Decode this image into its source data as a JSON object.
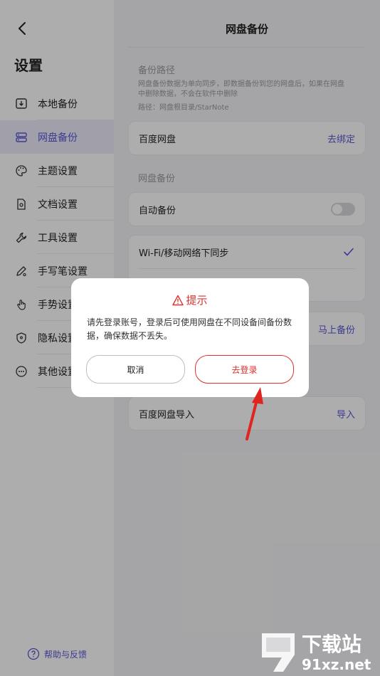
{
  "sidebar": {
    "title": "设置",
    "items": [
      {
        "label": "本地备份",
        "icon": "local-backup-icon"
      },
      {
        "label": "网盘备份",
        "icon": "cloud-disk-icon",
        "active": true
      },
      {
        "label": "主题设置",
        "icon": "palette-icon"
      },
      {
        "label": "文档设置",
        "icon": "document-settings-icon"
      },
      {
        "label": "工具设置",
        "icon": "wrench-icon"
      },
      {
        "label": "手写笔设置",
        "icon": "stylus-icon"
      },
      {
        "label": "手势设置",
        "icon": "hand-gesture-icon"
      },
      {
        "label": "隐私设置",
        "icon": "privacy-shield-icon"
      },
      {
        "label": "其他设置",
        "icon": "more-dots-icon"
      }
    ],
    "help_label": "帮助与反馈"
  },
  "main": {
    "title": "网盘备份",
    "path_section": {
      "title": "备份路径",
      "description": "网盘备份数据为单向同步，即数据备份到您的网盘后，如果在网盘中删除数据，不会在软件中删除",
      "path": "路径：网盘根目录/StarNote"
    },
    "baidu_card": {
      "label": "百度网盘",
      "action": "去绑定"
    },
    "backup_section_title": "网盘备份",
    "auto_backup": {
      "label": "自动备份",
      "enabled": false
    },
    "sync_card": {
      "label": "Wi-Fi/移动网络下同步",
      "checked": true
    },
    "backup_now_action": "马上备份",
    "import_card": {
      "label": "百度网盘导入",
      "action": "导入"
    }
  },
  "dialog": {
    "title": "提示",
    "message": "请先登录账号，登录后可使用网盘在不同设备间备份数据，确保数据不丢失。",
    "cancel_label": "取消",
    "confirm_label": "去登录"
  },
  "watermark": {
    "main": "下载站",
    "site": "91xz.net"
  },
  "colors": {
    "accent": "#5b56d6",
    "danger": "#e0312f",
    "active_bg": "#ecebfb"
  }
}
